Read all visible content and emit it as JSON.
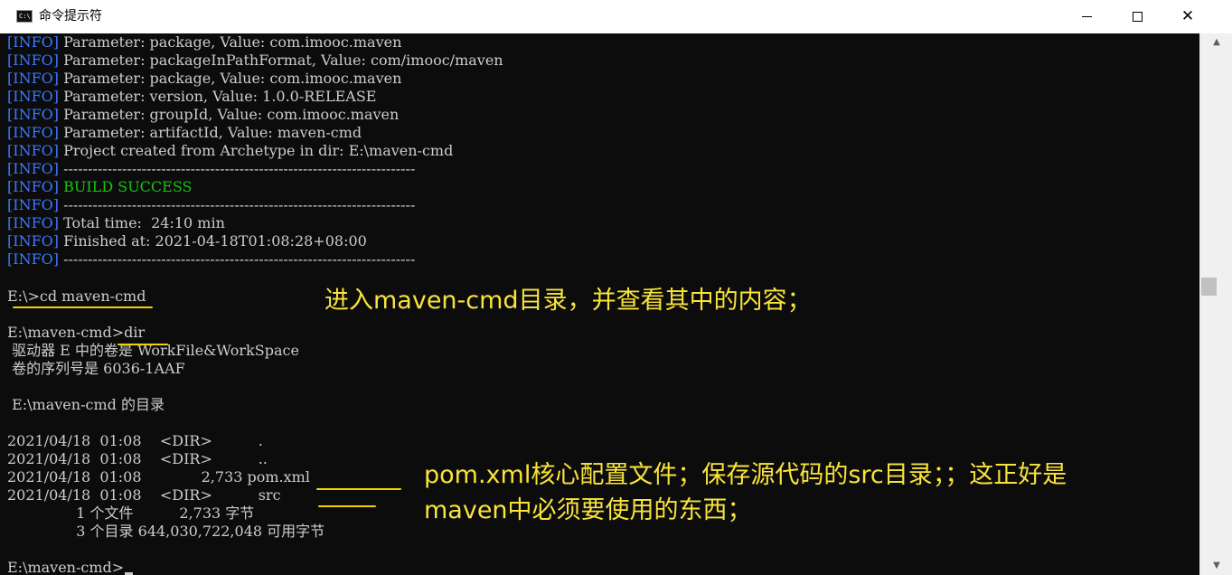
{
  "window": {
    "title": "命令提示符",
    "icon_text": "C:\\",
    "minimize_icon": "minimize-icon",
    "maximize_icon": "maximize-icon",
    "close_icon": "close-icon",
    "close_glyph": "✕"
  },
  "console": {
    "tag": "[INFO]",
    "info_lines": [
      " Parameter: package, Value: com.imooc.maven",
      " Parameter: packageInPathFormat, Value: com/imooc/maven",
      " Parameter: package, Value: com.imooc.maven",
      " Parameter: version, Value: 1.0.0-RELEASE",
      " Parameter: groupId, Value: com.imooc.maven",
      " Parameter: artifactId, Value: maven-cmd",
      " Project created from Archetype in dir: E:\\maven-cmd",
      " ------------------------------------------------------------------------"
    ],
    "build_success": "BUILD SUCCESS",
    "separator": " ------------------------------------------------------------------------",
    "total_time": " Total time:  24:10 min",
    "finished_at": " Finished at: 2021-04-18T01:08:28+08:00",
    "prompt_cd": "E:\\>cd maven-cmd",
    "prompt_dir": "E:\\maven-cmd>dir",
    "volume_line": " 驱动器 E 中的卷是 WorkFile&WorkSpace",
    "serial_line": " 卷的序列号是 6036-1AAF",
    "dir_of_line": " E:\\maven-cmd 的目录",
    "listing": [
      "2021/04/18  01:08    <DIR>          .",
      "2021/04/18  01:08    <DIR>          ..",
      "2021/04/18  01:08             2,733 pom.xml",
      "2021/04/18  01:08    <DIR>          src"
    ],
    "summary_files": "               1 个文件          2,733 字节",
    "summary_dirs": "               3 个目录 644,030,722,048 可用字节",
    "final_prompt": "E:\\maven-cmd>"
  },
  "annotations": {
    "note1": "进入maven-cmd目录，并查看其中的内容；",
    "note2_line1": "pom.xml核心配置文件；保存源代码的src目录；；这正好是",
    "note2_line2": "maven中必须要使用的东西；",
    "color": "#f9e33b"
  },
  "colors": {
    "background": "#0c0c0c",
    "text": "#cccccc",
    "info_tag": "#3b78ff",
    "success": "#16c60c"
  }
}
